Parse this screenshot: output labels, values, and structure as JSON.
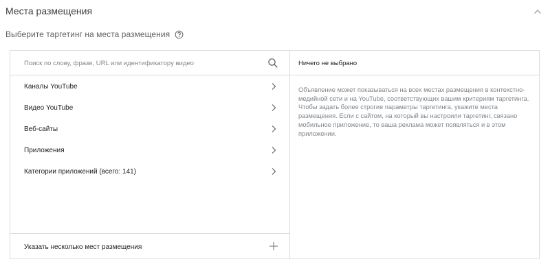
{
  "section": {
    "title": "Места размещения"
  },
  "subtitle": "Выберите таргетинг на места размещения",
  "search": {
    "placeholder": "Поиск по слову, фразе, URL или идентификатору видео"
  },
  "list": {
    "items": [
      {
        "label": "Каналы YouTube"
      },
      {
        "label": "Видео YouTube"
      },
      {
        "label": "Веб-сайты"
      },
      {
        "label": "Приложения"
      },
      {
        "label": "Категории приложений (всего: 141)"
      }
    ]
  },
  "add_multiple": {
    "label": "Указать несколько мест размещения"
  },
  "selection": {
    "empty_title": "Ничего не выбрано",
    "description": "Объявление может показываться на всех местах размещения в контекстно-медийной сети и на YouTube, соответствующих вашим критериям таргетинга. Чтобы задать более строгие параметры таргетинга, укажите места размещения. Если с сайтом, на который вы настроили таргетинг, связано мобильное приложение, то ваша реклама может появляться и в этом приложении."
  },
  "icons": {
    "collapse": "chevron-up-icon",
    "help": "help-circle-icon",
    "search": "search-icon",
    "item_arrow": "chevron-right-icon",
    "add": "plus-icon"
  },
  "colors": {
    "border": "#dadce0",
    "text_primary": "#202124",
    "text_secondary": "#80868b",
    "icon": "#5f6368"
  }
}
